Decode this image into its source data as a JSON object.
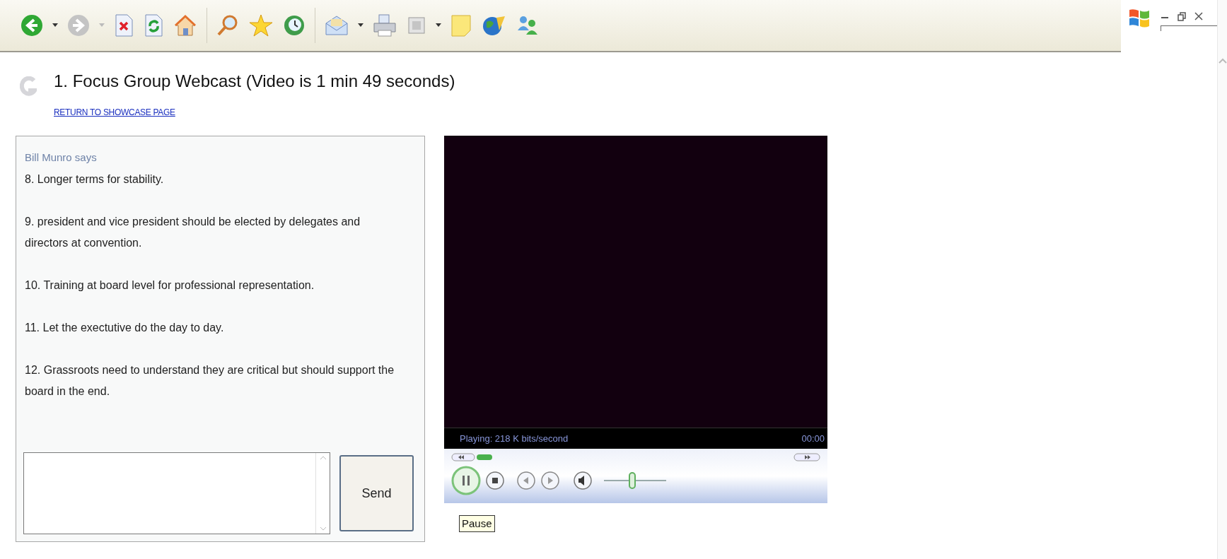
{
  "page": {
    "title": "1. Focus Group Webcast (Video is 1 min 49 seconds)",
    "return_link": "RETURN TO SHOWCASE PAGE"
  },
  "chat": {
    "sender": "Bill Munro says",
    "messages": [
      "8. Longer terms for stability.",
      "9. president and vice president should be elected by delegates and directors at convention.",
      "10. Training at board level for professional representation.",
      "11. Let the exectutive do the day to day.",
      "12. Grassroots need to understand they are critical but should support the board in the end."
    ],
    "send_button": "Send"
  },
  "player": {
    "status": "Playing: 218 K bits/second",
    "time": "00:00",
    "playing": true,
    "seek": {
      "level": 0.05
    },
    "volume": {
      "level": 0.45
    },
    "tooltip": "Pause"
  }
}
